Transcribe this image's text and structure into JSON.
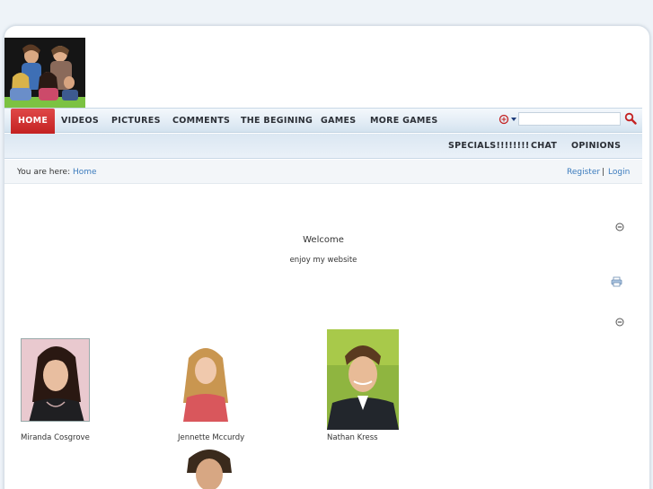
{
  "header": {
    "logo": "iCarly cast photo"
  },
  "nav": {
    "items": [
      {
        "label": "HOME",
        "active": true
      },
      {
        "label": "VIDEOS"
      },
      {
        "label": "PICTURES"
      },
      {
        "label": "COMMENTS"
      },
      {
        "label": "THE BEGINING"
      },
      {
        "label": "GAMES"
      },
      {
        "label": "MORE GAMES"
      }
    ],
    "sub_items": [
      {
        "label": "SPECIALS!!!!!!!!"
      },
      {
        "label": "CHAT"
      },
      {
        "label": "OPINIONS"
      }
    ],
    "active_color": "#c42222"
  },
  "search": {
    "value": "",
    "icon": "search-icon",
    "lang_icon": "language-selector-icon"
  },
  "breadcrumb": {
    "prefix": "You are here:",
    "home": "Home",
    "register": "Register",
    "separator": "|",
    "login": "Login"
  },
  "content": {
    "welcome_title": "Welcome",
    "welcome_sub": "enjoy my website",
    "cast": [
      {
        "name": "Miranda Cosgrove"
      },
      {
        "name": "Jennette Mccurdy"
      },
      {
        "name": "Nathan Kress"
      }
    ]
  }
}
